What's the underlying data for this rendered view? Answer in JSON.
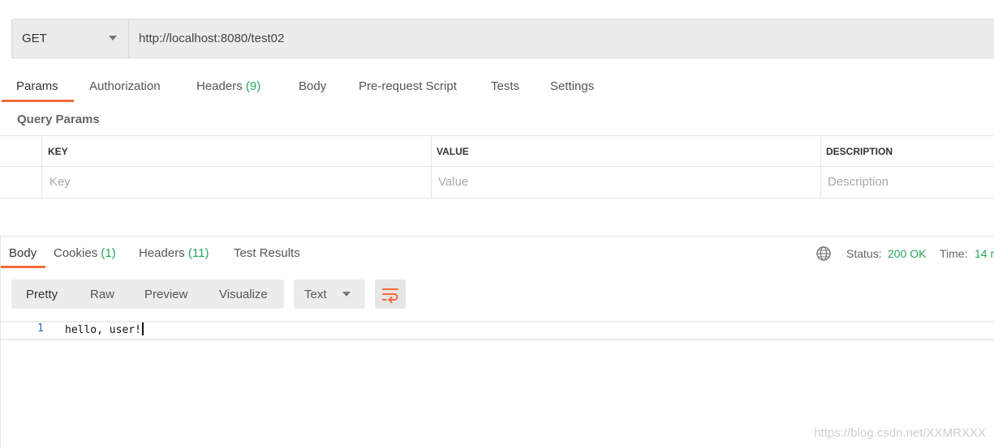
{
  "request": {
    "method": "GET",
    "url": "http://localhost:8080/test02"
  },
  "request_tabs": {
    "params": "Params",
    "authorization": "Authorization",
    "headers": "Headers",
    "headers_count": "(9)",
    "body": "Body",
    "prerequest": "Pre-request Script",
    "tests": "Tests",
    "settings": "Settings"
  },
  "query_params": {
    "title": "Query Params",
    "columns": {
      "key": "KEY",
      "value": "VALUE",
      "description": "DESCRIPTION"
    },
    "placeholders": {
      "key": "Key",
      "value": "Value",
      "description": "Description"
    }
  },
  "response_tabs": {
    "body": "Body",
    "cookies": "Cookies",
    "cookies_count": "(1)",
    "headers": "Headers",
    "headers_count": "(11)",
    "test_results": "Test Results"
  },
  "response_meta": {
    "status_label": "Status:",
    "status_value": "200 OK",
    "time_label": "Time:",
    "time_value": "14 r"
  },
  "response_toolbar": {
    "pretty": "Pretty",
    "raw": "Raw",
    "preview": "Preview",
    "visualize": "Visualize",
    "format": "Text"
  },
  "response_body": {
    "line_number": "1",
    "text": "hello, user!"
  },
  "watermark": "https://blog.csdn.net/XXMRXXX",
  "colors": {
    "accent": "#f26b3a",
    "success": "#26a55a"
  },
  "icons": {
    "globe": "globe-icon",
    "wrap": "wrap-lines-icon",
    "dropdown": "chevron-down-icon"
  }
}
